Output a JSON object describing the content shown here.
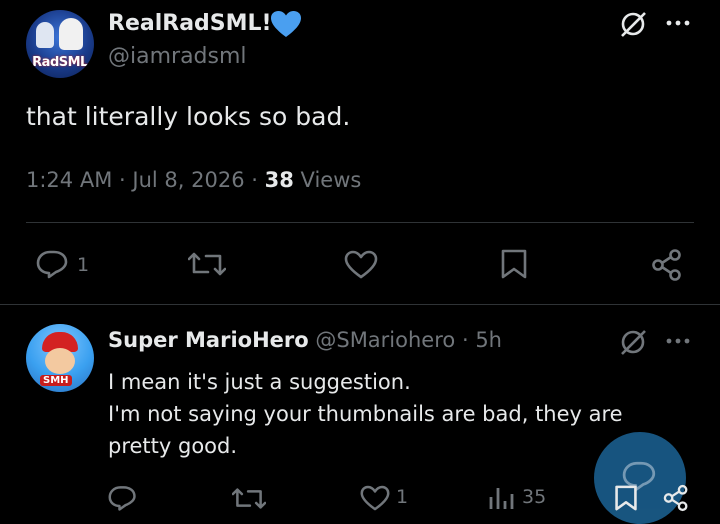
{
  "main_tweet": {
    "display_name": "RealRadSML!",
    "handle": "@iamradsml",
    "avatar_text": "RadSML",
    "text": "that literally looks so bad.",
    "time": "1:24 AM",
    "separator": "·",
    "date": "Jul 8, 2026",
    "views_count": "38",
    "views_label": "Views",
    "reply_count": "1",
    "colors": {
      "verified_badge": "#4a9ff0",
      "muted": "#71767b"
    }
  },
  "reply": {
    "display_name": "Super MarioHero",
    "handle": "@SMariohero",
    "separator": "·",
    "age": "5h",
    "avatar_text": "SMH",
    "lines": [
      "I mean it's just a suggestion.",
      "I'm not saying your thumbnails are bad, they are",
      "pretty good."
    ],
    "like_count": "1",
    "views_count": "35"
  },
  "icons": {
    "grok": "grok-icon",
    "more": "more-icon",
    "reply": "reply-icon",
    "retweet": "retweet-icon",
    "like": "heart-icon",
    "bookmark": "bookmark-icon",
    "share": "share-icon",
    "analytics": "analytics-icon",
    "compose": "compose-reply-icon"
  },
  "colors": {
    "background": "#000000",
    "text": "#e7e9ea",
    "divider": "#2f3336",
    "fab": "#1a5c8a"
  }
}
